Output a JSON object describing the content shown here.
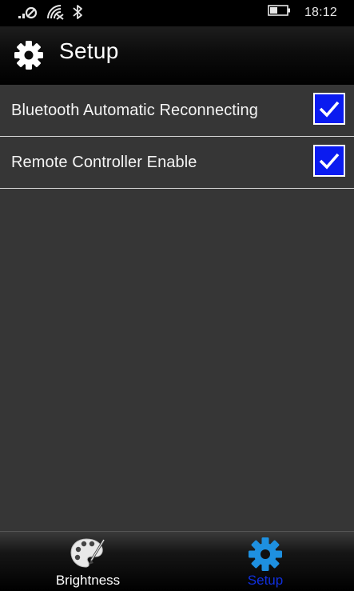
{
  "status_bar": {
    "time": "18:12",
    "icons": [
      "signal-no-sim-icon",
      "wifi-icon",
      "bluetooth-icon",
      "battery-icon"
    ],
    "battery_level": 0.45
  },
  "header": {
    "title": "Setup",
    "icon": "gear-icon"
  },
  "settings": {
    "items": [
      {
        "label": "Bluetooth Automatic Reconnecting",
        "checked": true
      },
      {
        "label": "Remote Controller Enable",
        "checked": true
      }
    ]
  },
  "bottom_nav": {
    "tabs": [
      {
        "label": "Brightness",
        "icon": "palette-icon",
        "active": false
      },
      {
        "label": "Setup",
        "icon": "gear-icon",
        "active": true
      }
    ]
  },
  "colors": {
    "checkbox_fill": "#0a1bf0",
    "active_tab": "#1030e0",
    "active_icon": "#1e90e0",
    "content_bg": "#363636"
  }
}
